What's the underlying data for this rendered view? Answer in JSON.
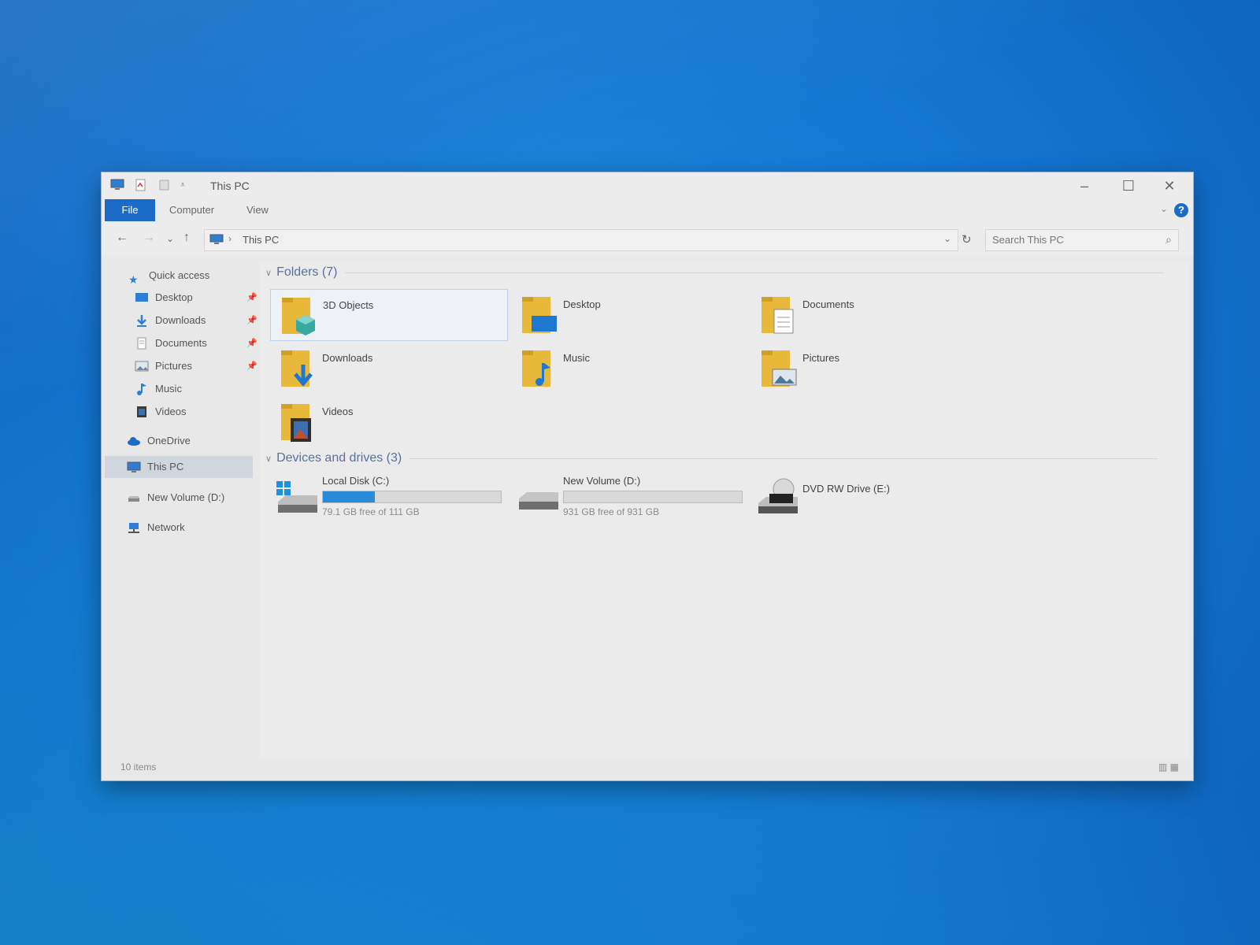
{
  "window": {
    "title": "This PC",
    "minimize": "–",
    "maximize": "☐",
    "close": "✕"
  },
  "ribbon": {
    "tabs": [
      "File",
      "Computer",
      "View"
    ],
    "help": "?",
    "collapse": "⌄"
  },
  "address": {
    "back": "←",
    "forward": "→",
    "recent": "⌄",
    "up": "↑",
    "separator": "›",
    "crumb": "This PC",
    "dropdown": "⌄",
    "refresh": "↻"
  },
  "search": {
    "placeholder": "Search This PC",
    "icon": "⌕"
  },
  "sidebar": {
    "quick_access": "Quick access",
    "items": [
      {
        "label": "Desktop",
        "pin": "📌",
        "icon": "desktop-icon"
      },
      {
        "label": "Downloads",
        "pin": "📌",
        "icon": "download-arrow-icon"
      },
      {
        "label": "Documents",
        "pin": "📌",
        "icon": "document-icon"
      },
      {
        "label": "Pictures",
        "pin": "📌",
        "icon": "picture-icon"
      },
      {
        "label": "Music",
        "icon": "music-note-icon"
      },
      {
        "label": "Videos",
        "icon": "video-icon"
      }
    ],
    "onedrive": "OneDrive",
    "this_pc": "This PC",
    "new_volume": "New Volume (D:)",
    "network": "Network"
  },
  "folders": {
    "header": "Folders (7)",
    "items": [
      "3D Objects",
      "Desktop",
      "Documents",
      "Downloads",
      "Music",
      "Pictures",
      "Videos"
    ]
  },
  "drives": {
    "header": "Devices and drives (3)",
    "items": [
      {
        "name": "Local Disk (C:)",
        "free": "79.1 GB free of 111 GB",
        "used_fraction": 0.29
      },
      {
        "name": "New Volume (D:)",
        "free": "931 GB free of 931 GB",
        "used_fraction": 0.0
      },
      {
        "name": "DVD RW Drive (E:)"
      }
    ]
  },
  "status": {
    "count": "10 items",
    "views": "▥ ▦"
  },
  "colors": {
    "accent": "#1b6cc7",
    "folder": "#e8b83a",
    "drive_fill": "#2a8bd8"
  }
}
